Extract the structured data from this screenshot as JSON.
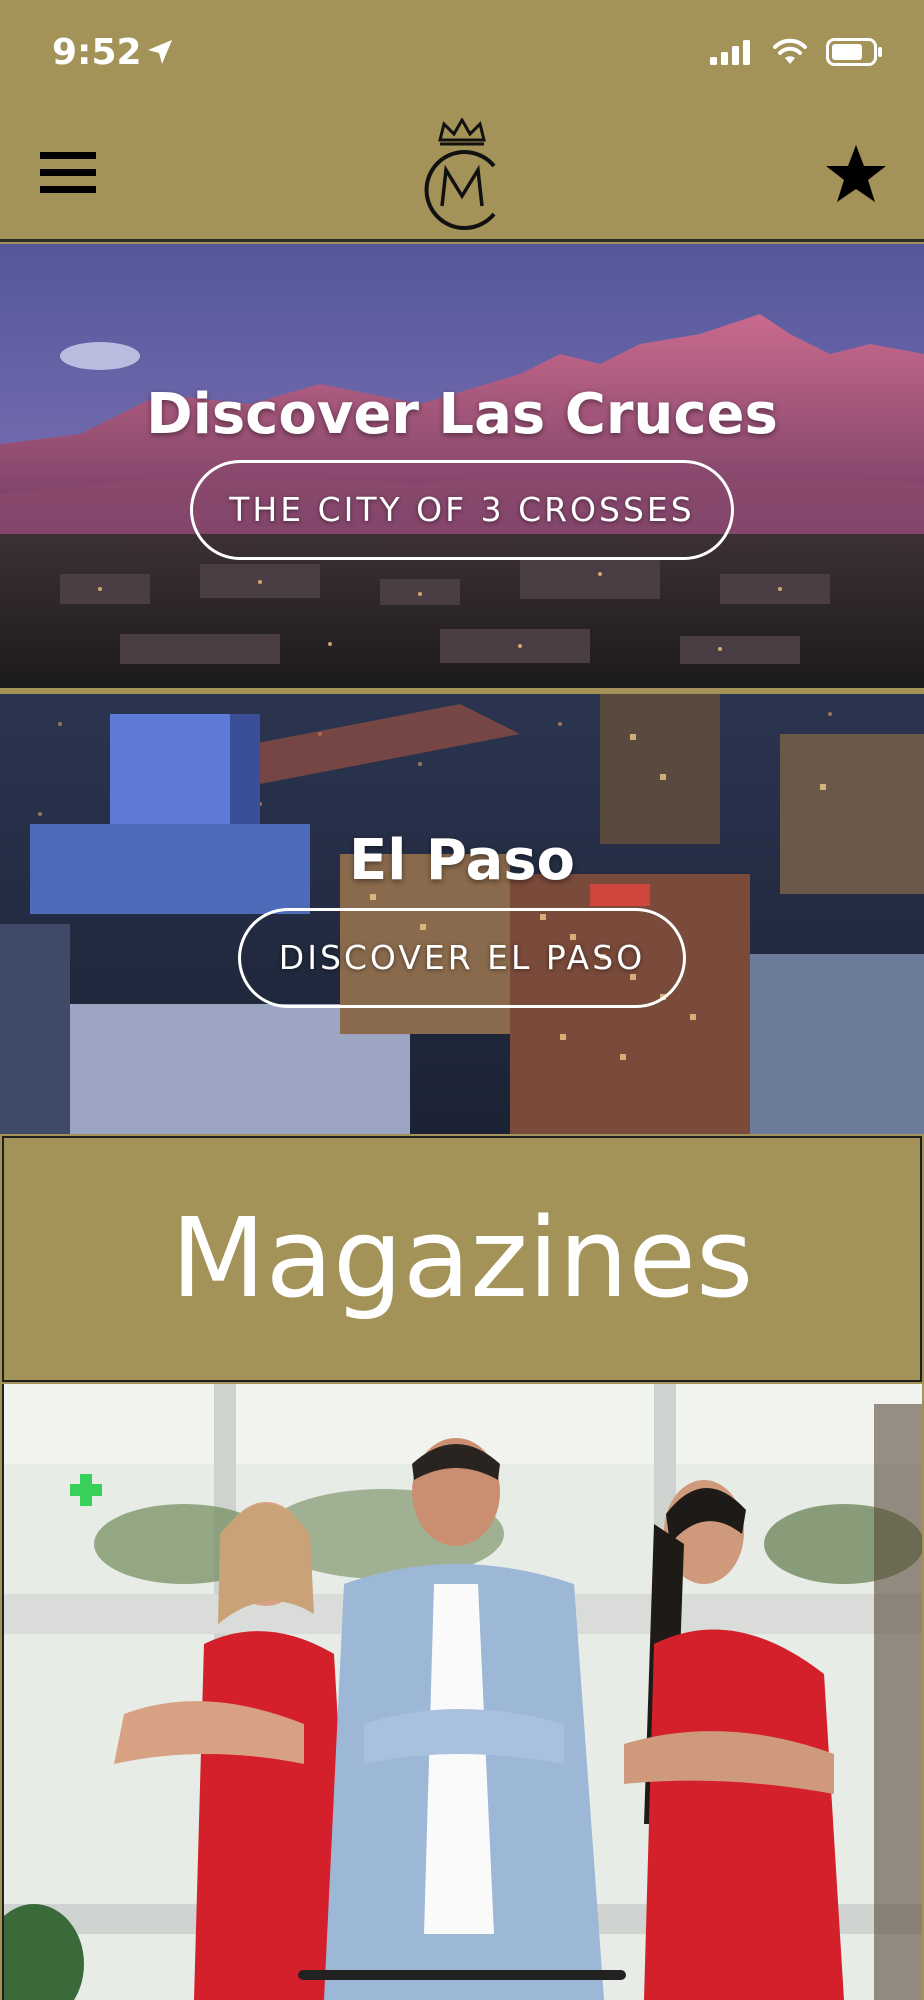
{
  "status_bar": {
    "time": "9:52"
  },
  "nav": {
    "menu_icon": "hamburger-icon",
    "logo_icon": "crown-monogram-logo",
    "favorite_icon": "star-icon"
  },
  "banners": [
    {
      "title": "Discover Las Cruces",
      "button": "THE CITY OF 3 CROSSES"
    },
    {
      "title": "El Paso",
      "button": "DISCOVER EL PASO"
    }
  ],
  "magazines": {
    "title": "Magazines"
  },
  "colors": {
    "brand": "#a39358",
    "text_on_brand": "#ffffff"
  }
}
